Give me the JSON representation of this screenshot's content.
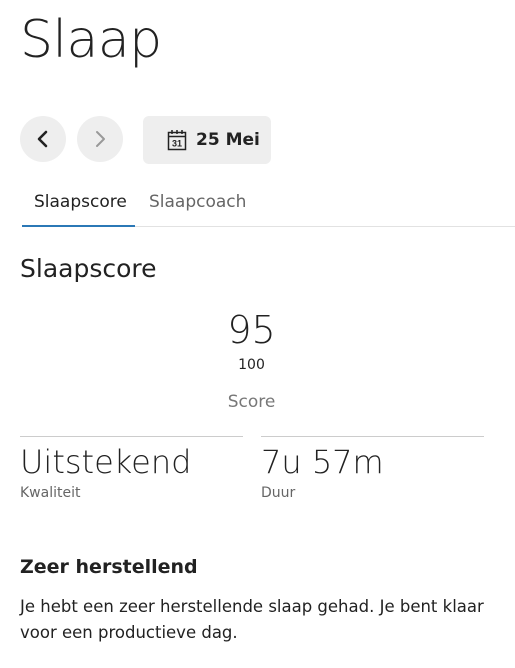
{
  "page": {
    "title": "Slaap"
  },
  "date_nav": {
    "prev_icon": "chevron-left-icon",
    "next_icon": "chevron-right-icon",
    "calendar_icon": "calendar-icon",
    "calendar_day": "31",
    "date_label": "25 Mei"
  },
  "tabs": [
    {
      "label": "Slaapscore",
      "active": true
    },
    {
      "label": "Slaapcoach",
      "active": false
    }
  ],
  "section": {
    "title": "Slaapscore"
  },
  "score": {
    "value": "95",
    "max": "100",
    "label": "Score"
  },
  "stats": {
    "quality": {
      "value": "Uitstekend",
      "caption": "Kwaliteit"
    },
    "duration": {
      "value": "7u 57m",
      "caption": "Duur"
    }
  },
  "summary": {
    "heading": "Zeer herstellend",
    "text": "Je hebt een zeer herstellende slaap gehad. Je bent klaar voor een productieve dag."
  },
  "colors": {
    "accent": "#2b78b6",
    "button_bg": "#eeeeee",
    "text": "#222222",
    "muted": "#666666"
  }
}
